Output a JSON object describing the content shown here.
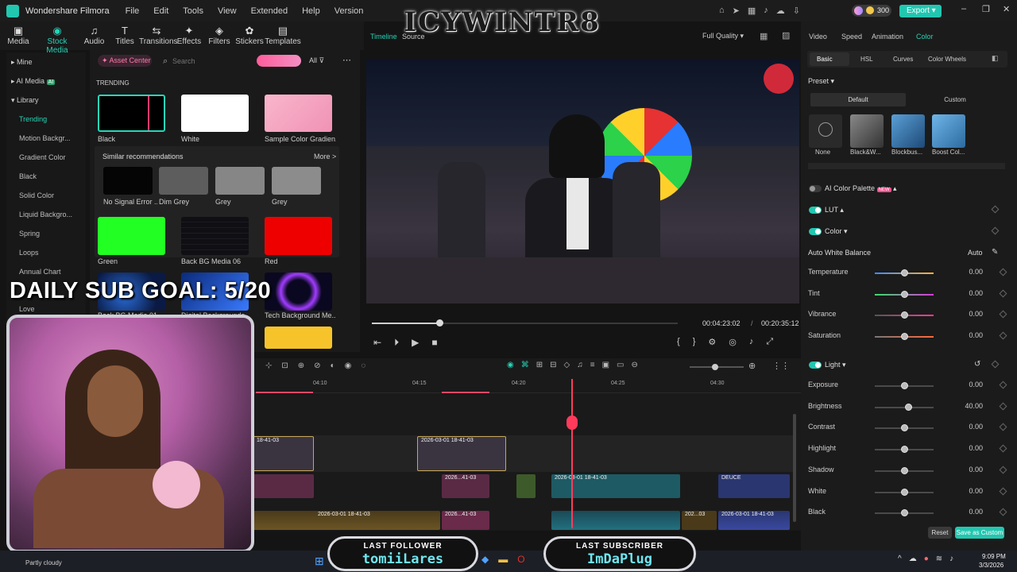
{
  "app": {
    "title": "Wondershare Filmora",
    "menu": [
      "File",
      "Edit",
      "Tools",
      "View",
      "Extended",
      "Help",
      "Version"
    ],
    "credits": "300",
    "export_label": "Export"
  },
  "toolbar": {
    "items": [
      "Media",
      "Stock Media",
      "Audio",
      "Titles",
      "Transitions",
      "Effects",
      "Filters",
      "Stickers",
      "Templates"
    ]
  },
  "leftnav": {
    "items": [
      "Mine",
      "AI Media",
      "Library",
      "Trending",
      "Motion Backgr...",
      "Gradient Color",
      "Black",
      "Solid Color",
      "Liquid Backgro...",
      "Spring",
      "Loops",
      "Annual Chart",
      "Love"
    ],
    "ai_badge": "AI"
  },
  "assets": {
    "asset_center": "Asset Center",
    "search_placeholder": "Search",
    "filter_all": "All",
    "section_trending": "TRENDING",
    "similar": "Similar recommendations",
    "more": "More >",
    "row1": [
      "Black",
      "White",
      "Sample Color Gradien..."
    ],
    "row2": [
      "No Signal Error ...",
      "Dim Grey",
      "Grey",
      "Grey"
    ],
    "row3": [
      "Green",
      "Back BG Media 06",
      "Red"
    ],
    "row4": [
      "Back BG Media 01",
      "Digital Backgrounds...",
      "Tech Background Me..."
    ]
  },
  "preview": {
    "tab_timeline": "Timeline",
    "tab_source": "Source",
    "quality": "Full Quality",
    "current_time": "00:04:23:02",
    "separator": "/",
    "total_time": "00:20:35:12",
    "progress": 0.22
  },
  "rightpanel": {
    "tabs": [
      "Video",
      "Speed",
      "Animation",
      "Color"
    ],
    "subtabs": [
      "Basic",
      "HSL",
      "Curves",
      "Color Wheels"
    ],
    "preset_label": "Preset",
    "preset_tabs": [
      "Default",
      "Custom"
    ],
    "presets": [
      "None",
      "Black&W...",
      "Blockbus...",
      "Boost Col..."
    ],
    "ai_palette": "AI Color Palette",
    "new_badge": "NEW",
    "lut": "LUT",
    "color": "Color",
    "awb": "Auto White Balance",
    "auto": "Auto",
    "color_rows": [
      {
        "label": "Temperature",
        "value": "0.00"
      },
      {
        "label": "Tint",
        "value": "0.00"
      },
      {
        "label": "Vibrance",
        "value": "0.00"
      },
      {
        "label": "Saturation",
        "value": "0.00"
      }
    ],
    "light": "Light",
    "light_rows": [
      {
        "label": "Exposure",
        "value": "0.00"
      },
      {
        "label": "Brightness",
        "value": "40.00"
      },
      {
        "label": "Contrast",
        "value": "0.00"
      },
      {
        "label": "Highlight",
        "value": "0.00"
      },
      {
        "label": "Shadow",
        "value": "0.00"
      },
      {
        "label": "White",
        "value": "0.00"
      },
      {
        "label": "Black",
        "value": "0.00"
      }
    ],
    "reset": "Reset",
    "save_custom": "Save as Custom"
  },
  "timeline": {
    "ticks": [
      "04:10",
      "04:15",
      "04:20",
      "04:25",
      "04:30"
    ],
    "clips": [
      "18-41-03",
      "2026-03-01 18-41-03",
      "2026...41-03",
      "2026-03-01 18-41-03",
      "DEUCE",
      "2026-03-01 18-41-03",
      "2026...41-03",
      "202...03",
      "2026-03-01 18-41-03"
    ]
  },
  "overlay": {
    "logo_text": "ICYWINTR8",
    "goal": "DAILY SUB GOAL: 5/20",
    "follower_label": "LAST FOLLOWER",
    "follower_name": "tomiiLares",
    "subscriber_label": "LAST SUBSCRIBER",
    "subscriber_name": "ImDaPlug"
  },
  "taskbar": {
    "weather": "Partly cloudy",
    "time": "9:09 PM",
    "date": "3/3/2026"
  }
}
